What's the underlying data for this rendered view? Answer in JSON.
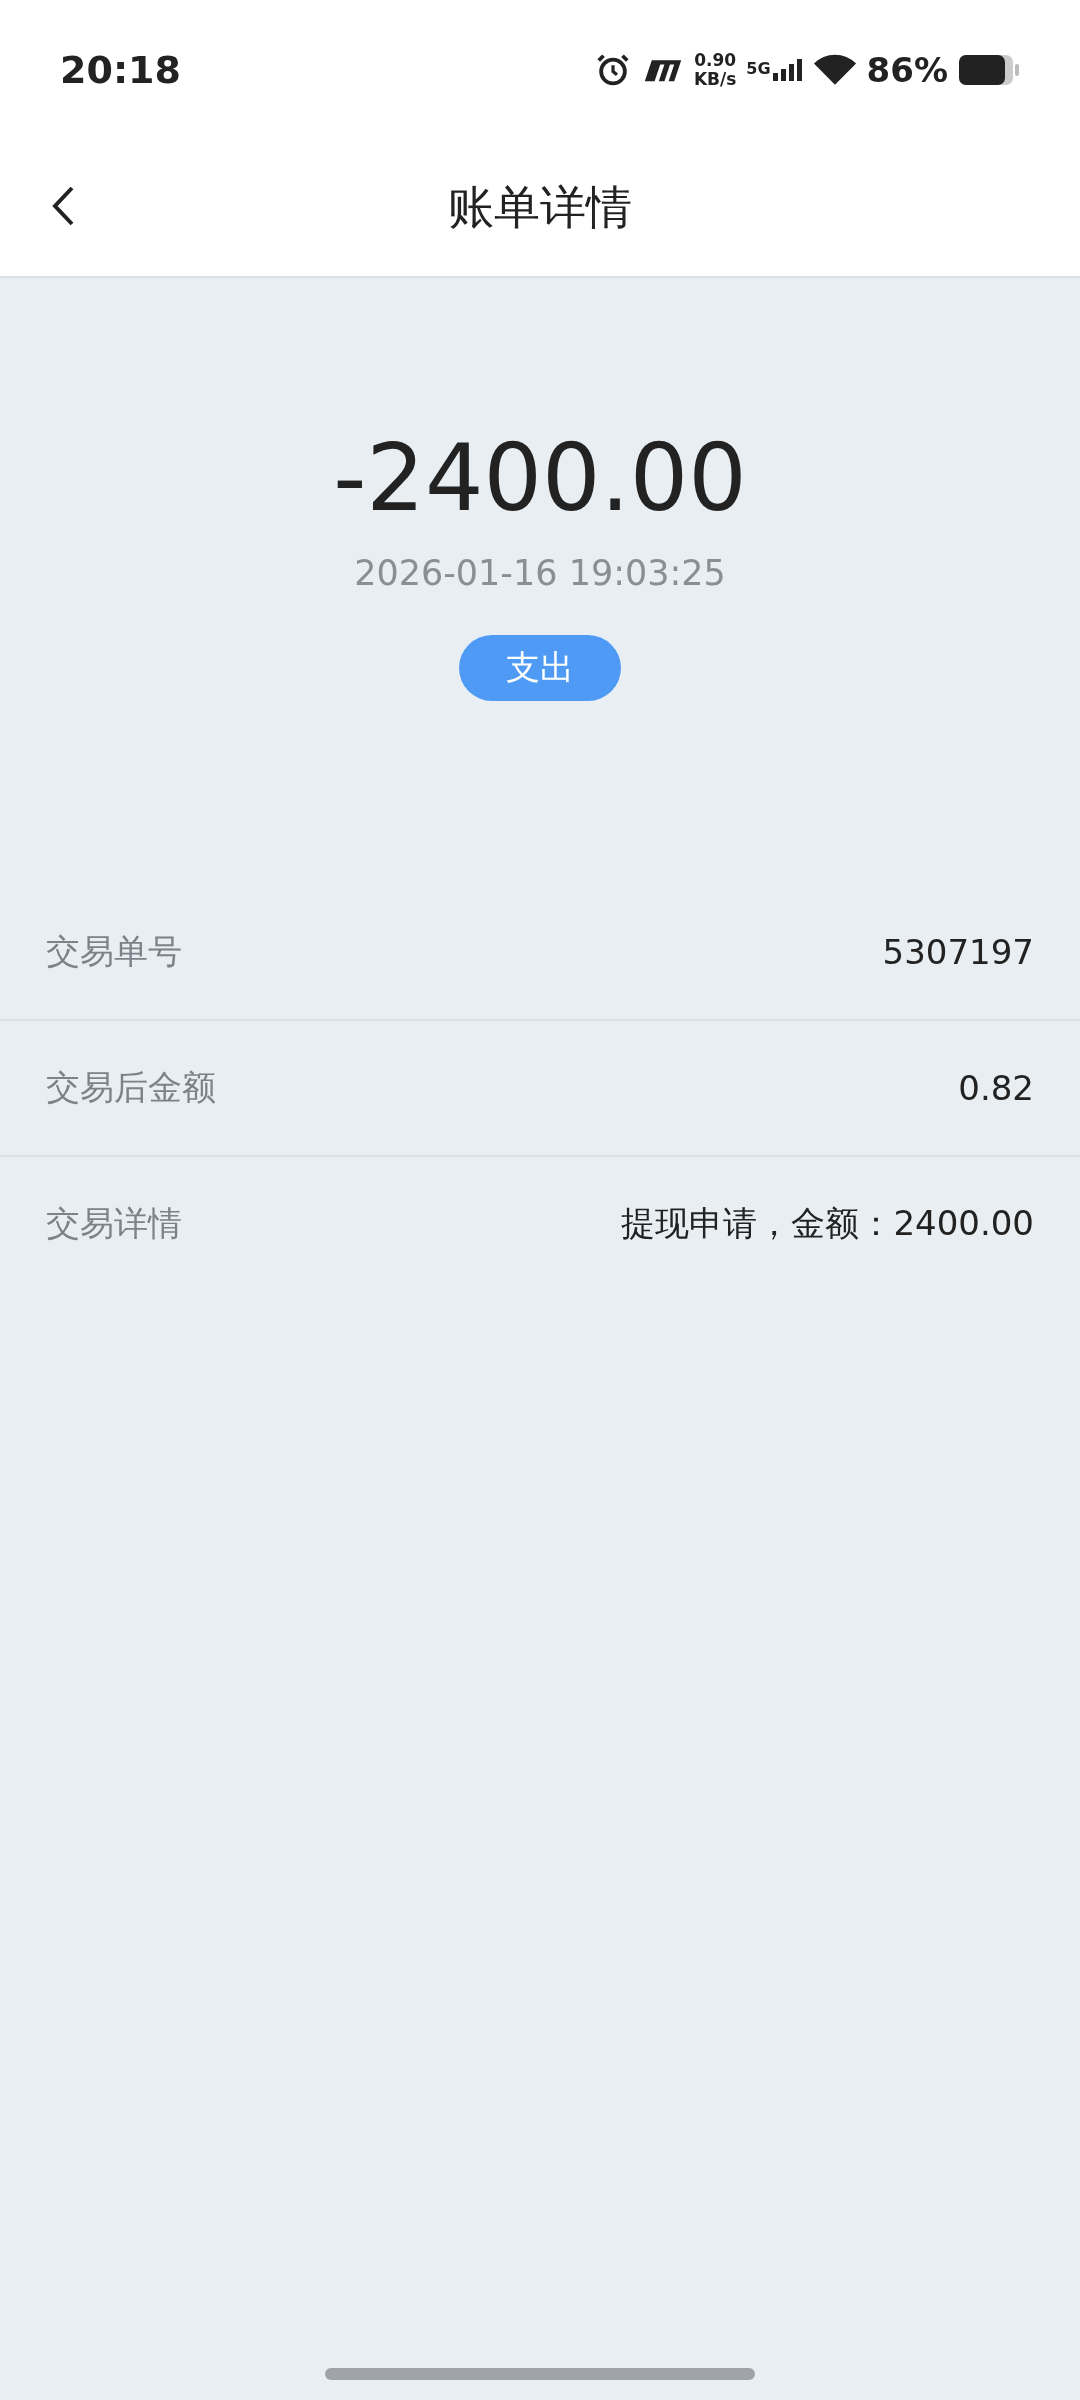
{
  "status_bar": {
    "time": "20:18",
    "net_speed_value": "0.90",
    "net_speed_unit": "KB/s",
    "network_type": "5G",
    "battery_percent": "86%"
  },
  "header": {
    "title": "账单详情"
  },
  "summary": {
    "amount": "-2400.00",
    "datetime": "2026-01-16 19:03:25",
    "tag": "支出"
  },
  "details": [
    {
      "label": "交易单号",
      "value": "5307197"
    },
    {
      "label": "交易后金额",
      "value": "0.82"
    },
    {
      "label": "交易详情",
      "value": "提现申请，金额：2400.00"
    }
  ]
}
